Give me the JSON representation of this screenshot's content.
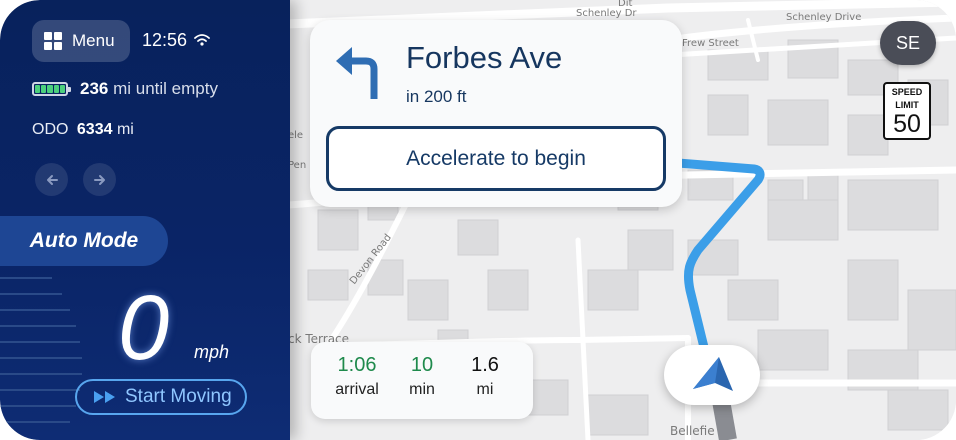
{
  "menu": {
    "label": "Menu"
  },
  "status": {
    "time": "12:56"
  },
  "vehicle": {
    "range_value": "236",
    "range_label": "mi until empty",
    "odo_label": "ODO",
    "odo_value": "6334",
    "odo_unit": "mi",
    "battery_level": 1.0
  },
  "drive": {
    "mode": "Auto Mode",
    "speed": "0",
    "speed_unit": "mph",
    "start_label": "Start Moving"
  },
  "navigation": {
    "street": "Forbes Ave",
    "distance": "in 200 ft",
    "action_label": "Accelerate to begin",
    "heading": "SE"
  },
  "speed_limit": {
    "title_line1": "SPEED",
    "title_line2": "LIMIT",
    "value": "50"
  },
  "eta": {
    "arrival_value": "1:06",
    "arrival_label": "arrival",
    "minutes_value": "10",
    "minutes_label": "min",
    "miles_value": "1.6",
    "miles_label": "mi"
  },
  "map_labels": {
    "schenley_top": "Schenley Dr",
    "schenley_drive": "Schenley Drive",
    "frew": "Frew Street",
    "devon": "Devon Road",
    "terrace": "ck Terrace",
    "bellefield": "Bellefie",
    "ele": "ele",
    "pen": "Pen",
    "dit": "Dit"
  },
  "colors": {
    "panel_bg": "#0a2466",
    "route": "#3b9ee8",
    "eta_green": "#1f8a4c",
    "text_dark": "#16365f",
    "arrow_blue": "#2f6db3"
  }
}
